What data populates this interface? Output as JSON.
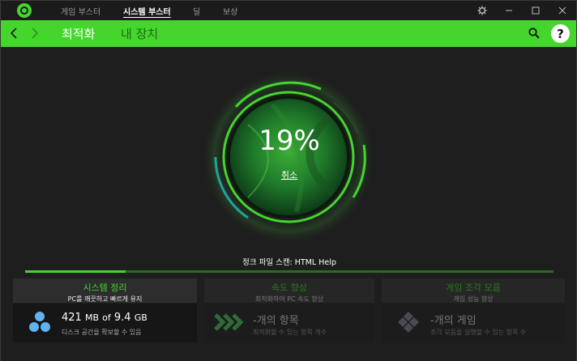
{
  "titlebar": {
    "tabs": [
      {
        "label": "게임 부스터",
        "active": false
      },
      {
        "label": "시스템 부스터",
        "active": true
      },
      {
        "label": "딜",
        "active": false
      },
      {
        "label": "보상",
        "active": false
      }
    ],
    "icons": [
      "gear-icon",
      "minimize-icon",
      "maximize-icon",
      "close-icon"
    ]
  },
  "nav": {
    "tabs": [
      {
        "label": "최적화",
        "active": true
      },
      {
        "label": "내 장치",
        "active": false
      }
    ],
    "help_label": "?"
  },
  "scan": {
    "percent_label": "19%",
    "progress": 0.19,
    "cancel_label": "취소",
    "status": "정크 파일 스캔: HTML Help"
  },
  "cards": [
    {
      "title": "시스템 정리",
      "subtitle": "PC를 깨끗하고 빠르게 유지",
      "value": "421",
      "unit": "MB",
      "of": "of",
      "total": "9.4",
      "total_unit": "GB",
      "desc": "디스크 공간을 확보할 수 있음",
      "icon": "bubbles-icon"
    },
    {
      "title": "속도 향상",
      "subtitle": "최적화하여 PC 속도 향상",
      "main": "-개의 항목",
      "desc": "최적화할 수 있는 항목 개수",
      "icon": "chevrons-icon"
    },
    {
      "title": "게임 조각 모음",
      "subtitle": "게임 성능 향상",
      "main": "-개의 게임",
      "desc": "조각 모음을 실행할 수 있는 항목 수",
      "icon": "diamonds-icon"
    }
  ],
  "colors": {
    "accent": "#44d62c",
    "background": "#1e1e1e"
  }
}
